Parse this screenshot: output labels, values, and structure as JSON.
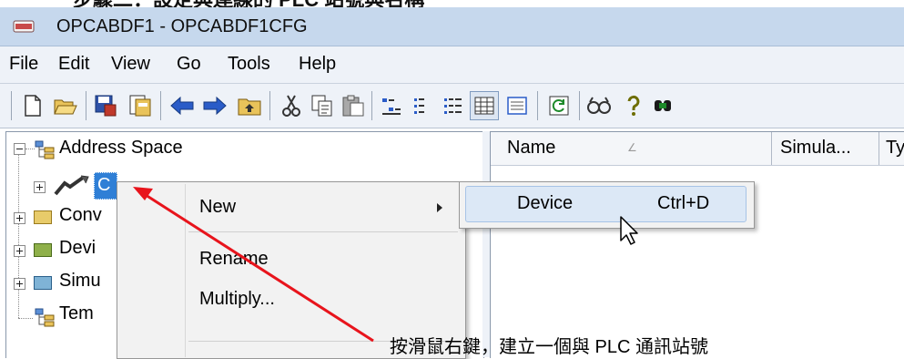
{
  "banner": {
    "text": "步驟二：設定與連線的 PLC 站號與名稱"
  },
  "window": {
    "title": "OPCABDF1 - OPCABDF1CFG"
  },
  "menu": [
    "File",
    "Edit",
    "View",
    "Go",
    "Tools",
    "Help"
  ],
  "toolbar": {
    "icons": [
      "new-file-icon",
      "open-folder-icon",
      "save-icon",
      "save-all-icon",
      "back-arrow-icon",
      "forward-arrow-icon",
      "up-folder-icon",
      "cut-icon",
      "copy-icon",
      "paste-icon",
      "small-icons-view-icon",
      "list-view-icon",
      "details-view-icon",
      "table-view-icon",
      "form-view-icon",
      "refresh-icon",
      "find-icon",
      "help-icon",
      "run-icon"
    ]
  },
  "tree": {
    "root": "Address Space",
    "selected": "C",
    "nodes": [
      "Conv",
      "Devi",
      "Simu",
      "Tem"
    ]
  },
  "list": {
    "columns": [
      "Name",
      "Simula...",
      "Ty"
    ]
  },
  "context_menu": {
    "items": [
      "New",
      "Rename",
      "Multiply..."
    ]
  },
  "submenu": {
    "item": "Device",
    "shortcut": "Ctrl+D"
  },
  "annotation": {
    "text": "按滑鼠右鍵，建立一個與 PLC 通訊站號",
    "arrow_color": "#e8141c"
  }
}
